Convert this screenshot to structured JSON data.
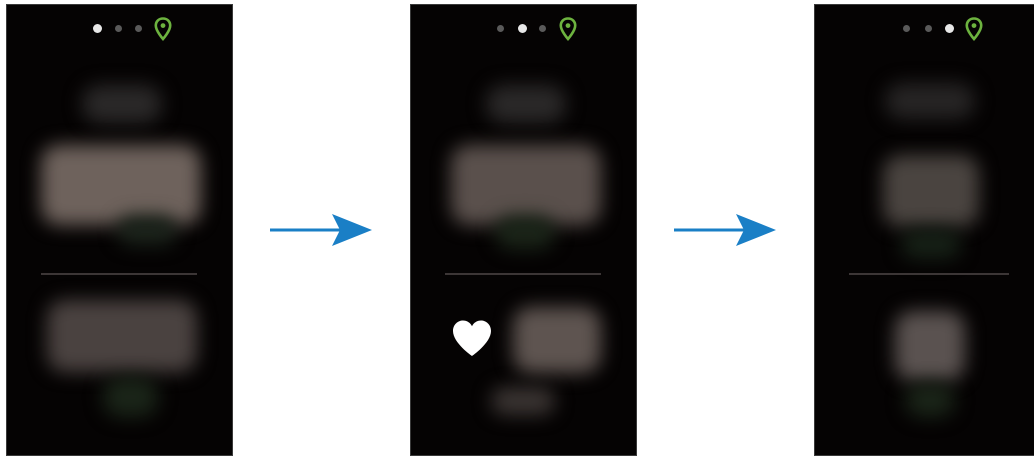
{
  "screens": [
    {
      "page_indicator": {
        "total_pages": 3,
        "active_page": 1,
        "location_icon": "location-pin-icon"
      }
    },
    {
      "page_indicator": {
        "total_pages": 3,
        "active_page": 2,
        "location_icon": "location-pin-icon"
      },
      "icon": "heart-icon"
    },
    {
      "page_indicator": {
        "total_pages": 3,
        "active_page": 3,
        "location_icon": "location-pin-icon"
      }
    }
  ],
  "transition_arrows": [
    "right-arrow-icon",
    "right-arrow-icon"
  ],
  "colors": {
    "screen_background": "#050303",
    "page_border": "#ffffff",
    "location_pin": "#6db33f",
    "arrow": "#1a7fc6",
    "active_dot": "#e8e8e8",
    "inactive_dot": "#5a5a5a",
    "heart": "#ffffff"
  }
}
